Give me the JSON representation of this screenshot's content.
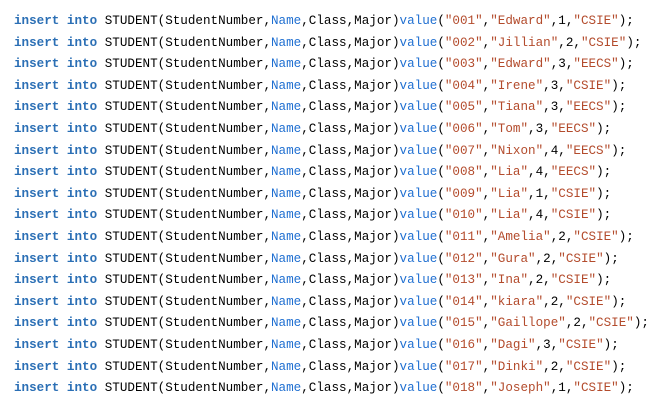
{
  "editor": {
    "lines": [
      {
        "k1": "insert",
        "k2": "into",
        "table": "STUDENT",
        "c_open": "(",
        "col1": "StudentNumber",
        "comma1": ",",
        "col2": "Name",
        "comma2": ",",
        "col3": "Class",
        "comma3": ",",
        "col4": "Major",
        "c_close": ")",
        "valuekw": "value",
        "v_open": "(",
        "num": "\"001\"",
        "vcomma1": ",",
        "name": "\"Edward\"",
        "vcomma2": ",",
        "cls": "1",
        "vcomma3": ",",
        "major": "\"CSIE\"",
        "end": ");"
      },
      {
        "k1": "insert",
        "k2": "into",
        "table": "STUDENT",
        "c_open": "(",
        "col1": "StudentNumber",
        "comma1": ",",
        "col2": "Name",
        "comma2": ",",
        "col3": "Class",
        "comma3": ",",
        "col4": "Major",
        "c_close": ")",
        "valuekw": "value",
        "v_open": "(",
        "num": "\"002\"",
        "vcomma1": ",",
        "name": "\"Jillian\"",
        "vcomma2": ",",
        "cls": "2",
        "vcomma3": ",",
        "major": "\"CSIE\"",
        "end": ");"
      },
      {
        "k1": "insert",
        "k2": "into",
        "table": "STUDENT",
        "c_open": "(",
        "col1": "StudentNumber",
        "comma1": ",",
        "col2": "Name",
        "comma2": ",",
        "col3": "Class",
        "comma3": ",",
        "col4": "Major",
        "c_close": ")",
        "valuekw": "value",
        "v_open": "(",
        "num": "\"003\"",
        "vcomma1": ",",
        "name": "\"Edward\"",
        "vcomma2": ",",
        "cls": "3",
        "vcomma3": ",",
        "major": "\"EECS\"",
        "end": ");"
      },
      {
        "k1": "insert",
        "k2": "into",
        "table": "STUDENT",
        "c_open": "(",
        "col1": "StudentNumber",
        "comma1": ",",
        "col2": "Name",
        "comma2": ",",
        "col3": "Class",
        "comma3": ",",
        "col4": "Major",
        "c_close": ")",
        "valuekw": "value",
        "v_open": "(",
        "num": "\"004\"",
        "vcomma1": ",",
        "name": "\"Irene\"",
        "vcomma2": ",",
        "cls": "3",
        "vcomma3": ",",
        "major": "\"CSIE\"",
        "end": ");"
      },
      {
        "k1": "insert",
        "k2": "into",
        "table": "STUDENT",
        "c_open": "(",
        "col1": "StudentNumber",
        "comma1": ",",
        "col2": "Name",
        "comma2": ",",
        "col3": "Class",
        "comma3": ",",
        "col4": "Major",
        "c_close": ")",
        "valuekw": "value",
        "v_open": "(",
        "num": "\"005\"",
        "vcomma1": ",",
        "name": "\"Tiana\"",
        "vcomma2": ",",
        "cls": "3",
        "vcomma3": ",",
        "major": "\"EECS\"",
        "end": ");"
      },
      {
        "k1": "insert",
        "k2": "into",
        "table": "STUDENT",
        "c_open": "(",
        "col1": "StudentNumber",
        "comma1": ",",
        "col2": "Name",
        "comma2": ",",
        "col3": "Class",
        "comma3": ",",
        "col4": "Major",
        "c_close": ")",
        "valuekw": "value",
        "v_open": "(",
        "num": "\"006\"",
        "vcomma1": ",",
        "name": "\"Tom\"",
        "vcomma2": ",",
        "cls": "3",
        "vcomma3": ",",
        "major": "\"EECS\"",
        "end": ");"
      },
      {
        "k1": "insert",
        "k2": "into",
        "table": "STUDENT",
        "c_open": "(",
        "col1": "StudentNumber",
        "comma1": ",",
        "col2": "Name",
        "comma2": ",",
        "col3": "Class",
        "comma3": ",",
        "col4": "Major",
        "c_close": ")",
        "valuekw": "value",
        "v_open": "(",
        "num": "\"007\"",
        "vcomma1": ",",
        "name": "\"Nixon\"",
        "vcomma2": ",",
        "cls": "4",
        "vcomma3": ",",
        "major": "\"EECS\"",
        "end": ");"
      },
      {
        "k1": "insert",
        "k2": "into",
        "table": "STUDENT",
        "c_open": "(",
        "col1": "StudentNumber",
        "comma1": ",",
        "col2": "Name",
        "comma2": ",",
        "col3": "Class",
        "comma3": ",",
        "col4": "Major",
        "c_close": ")",
        "valuekw": "value",
        "v_open": "(",
        "num": "\"008\"",
        "vcomma1": ",",
        "name": "\"Lia\"",
        "vcomma2": ",",
        "cls": "4",
        "vcomma3": ",",
        "major": "\"EECS\"",
        "end": ");"
      },
      {
        "k1": "insert",
        "k2": "into",
        "table": "STUDENT",
        "c_open": "(",
        "col1": "StudentNumber",
        "comma1": ",",
        "col2": "Name",
        "comma2": ",",
        "col3": "Class",
        "comma3": ",",
        "col4": "Major",
        "c_close": ")",
        "valuekw": "value",
        "v_open": "(",
        "num": "\"009\"",
        "vcomma1": ",",
        "name": "\"Lia\"",
        "vcomma2": ",",
        "cls": "1",
        "vcomma3": ",",
        "major": "\"CSIE\"",
        "end": ");"
      },
      {
        "k1": "insert",
        "k2": "into",
        "table": "STUDENT",
        "c_open": "(",
        "col1": "StudentNumber",
        "comma1": ",",
        "col2": "Name",
        "comma2": ",",
        "col3": "Class",
        "comma3": ",",
        "col4": "Major",
        "c_close": ")",
        "valuekw": "value",
        "v_open": "(",
        "num": "\"010\"",
        "vcomma1": ",",
        "name": "\"Lia\"",
        "vcomma2": ",",
        "cls": "4",
        "vcomma3": ",",
        "major": "\"CSIE\"",
        "end": ");"
      },
      {
        "k1": "insert",
        "k2": "into",
        "table": "STUDENT",
        "c_open": "(",
        "col1": "StudentNumber",
        "comma1": ",",
        "col2": "Name",
        "comma2": ",",
        "col3": "Class",
        "comma3": ",",
        "col4": "Major",
        "c_close": ")",
        "valuekw": "value",
        "v_open": "(",
        "num": "\"011\"",
        "vcomma1": ",",
        "name": "\"Amelia\"",
        "vcomma2": ",",
        "cls": "2",
        "vcomma3": ",",
        "major": "\"CSIE\"",
        "end": ");"
      },
      {
        "k1": "insert",
        "k2": "into",
        "table": "STUDENT",
        "c_open": "(",
        "col1": "StudentNumber",
        "comma1": ",",
        "col2": "Name",
        "comma2": ",",
        "col3": "Class",
        "comma3": ",",
        "col4": "Major",
        "c_close": ")",
        "valuekw": "value",
        "v_open": "(",
        "num": "\"012\"",
        "vcomma1": ",",
        "name": "\"Gura\"",
        "vcomma2": ",",
        "cls": "2",
        "vcomma3": ",",
        "major": "\"CSIE\"",
        "end": ");"
      },
      {
        "k1": "insert",
        "k2": "into",
        "table": "STUDENT",
        "c_open": "(",
        "col1": "StudentNumber",
        "comma1": ",",
        "col2": "Name",
        "comma2": ",",
        "col3": "Class",
        "comma3": ",",
        "col4": "Major",
        "c_close": ")",
        "valuekw": "value",
        "v_open": "(",
        "num": "\"013\"",
        "vcomma1": ",",
        "name": "\"Ina\"",
        "vcomma2": ",",
        "cls": "2",
        "vcomma3": ",",
        "major": "\"CSIE\"",
        "end": ");"
      },
      {
        "k1": "insert",
        "k2": "into",
        "table": "STUDENT",
        "c_open": "(",
        "col1": "StudentNumber",
        "comma1": ",",
        "col2": "Name",
        "comma2": ",",
        "col3": "Class",
        "comma3": ",",
        "col4": "Major",
        "c_close": ")",
        "valuekw": "value",
        "v_open": "(",
        "num": "\"014\"",
        "vcomma1": ",",
        "name": "\"kiara\"",
        "vcomma2": ",",
        "cls": "2",
        "vcomma3": ",",
        "major": "\"CSIE\"",
        "end": ");"
      },
      {
        "k1": "insert",
        "k2": "into",
        "table": "STUDENT",
        "c_open": "(",
        "col1": "StudentNumber",
        "comma1": ",",
        "col2": "Name",
        "comma2": ",",
        "col3": "Class",
        "comma3": ",",
        "col4": "Major",
        "c_close": ")",
        "valuekw": "value",
        "v_open": "(",
        "num": "\"015\"",
        "vcomma1": ",",
        "name": "\"Gaillope\"",
        "vcomma2": ",",
        "cls": "2",
        "vcomma3": ",",
        "major": "\"CSIE\"",
        "end": ");"
      },
      {
        "k1": "insert",
        "k2": "into",
        "table": "STUDENT",
        "c_open": "(",
        "col1": "StudentNumber",
        "comma1": ",",
        "col2": "Name",
        "comma2": ",",
        "col3": "Class",
        "comma3": ",",
        "col4": "Major",
        "c_close": ")",
        "valuekw": "value",
        "v_open": "(",
        "num": "\"016\"",
        "vcomma1": ",",
        "name": "\"Dagi\"",
        "vcomma2": ",",
        "cls": "3",
        "vcomma3": ",",
        "major": "\"CSIE\"",
        "end": ");"
      },
      {
        "k1": "insert",
        "k2": "into",
        "table": "STUDENT",
        "c_open": "(",
        "col1": "StudentNumber",
        "comma1": ",",
        "col2": "Name",
        "comma2": ",",
        "col3": "Class",
        "comma3": ",",
        "col4": "Major",
        "c_close": ")",
        "valuekw": "value",
        "v_open": "(",
        "num": "\"017\"",
        "vcomma1": ",",
        "name": "\"Dinki\"",
        "vcomma2": ",",
        "cls": "2",
        "vcomma3": ",",
        "major": "\"CSIE\"",
        "end": ");"
      },
      {
        "k1": "insert",
        "k2": "into",
        "table": "STUDENT",
        "c_open": "(",
        "col1": "StudentNumber",
        "comma1": ",",
        "col2": "Name",
        "comma2": ",",
        "col3": "Class",
        "comma3": ",",
        "col4": "Major",
        "c_close": ")",
        "valuekw": "value",
        "v_open": "(",
        "num": "\"018\"",
        "vcomma1": ",",
        "name": "\"Joseph\"",
        "vcomma2": ",",
        "cls": "1",
        "vcomma3": ",",
        "major": "\"CSIE\"",
        "end": ");"
      }
    ]
  },
  "colors": {
    "keyword": "#2b6fb5",
    "identifier_blue": "#1f6fd1",
    "string": "#b34b2c",
    "plain": "#000000",
    "background": "#ffffff"
  }
}
